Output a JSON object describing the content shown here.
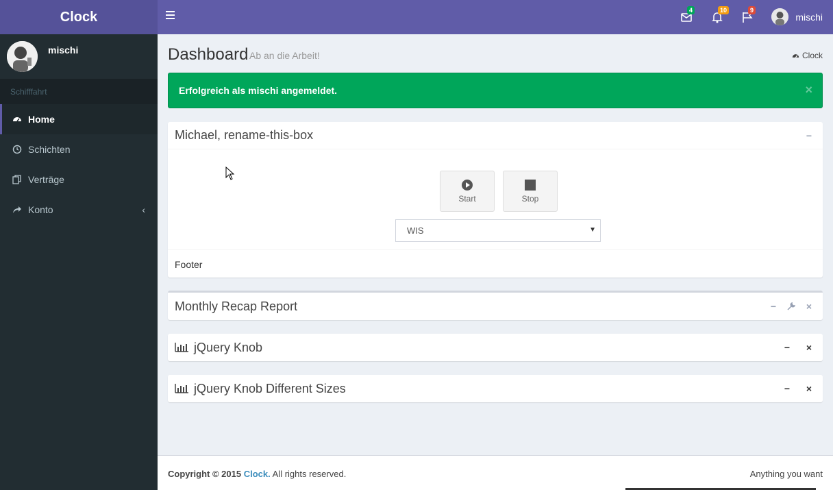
{
  "app": {
    "logo": "Clock"
  },
  "header": {
    "notifications": [
      {
        "icon": "envelope-icon",
        "badge": "4",
        "color": "#00a65a"
      },
      {
        "icon": "bell-icon",
        "badge": "10",
        "color": "#f39c12"
      },
      {
        "icon": "flag-icon",
        "badge": "9",
        "color": "#dd4b39"
      }
    ],
    "user": "mischi"
  },
  "sidebar": {
    "user": "mischi",
    "section": "Schifffahrt",
    "items": [
      {
        "label": "Home",
        "icon": "dashboard-icon",
        "active": true
      },
      {
        "label": "Schichten",
        "icon": "clock-icon"
      },
      {
        "label": "Verträge",
        "icon": "files-icon"
      },
      {
        "label": "Konto",
        "icon": "share-icon",
        "chevron": "‹"
      }
    ]
  },
  "page": {
    "title": "Dashboard",
    "subtitle": "Ab an die Arbeit!",
    "breadcrumb": "Clock"
  },
  "alert": {
    "message": "Erfolgreich als mischi angemeldet.",
    "close": "×"
  },
  "box_timer": {
    "title": "Michael, rename-this-box",
    "start_label": "Start",
    "stop_label": "Stop",
    "select_value": "WIS",
    "footer": "Footer"
  },
  "box_recap": {
    "title": "Monthly Recap Report"
  },
  "box_knob": {
    "title": "jQuery Knob"
  },
  "box_knob_sizes": {
    "title": "jQuery Knob Different Sizes"
  },
  "footer": {
    "copyright": "Copyright © 2015",
    "brand": "Clock.",
    "rights": "All rights reserved.",
    "right_text": "Anything you want"
  }
}
